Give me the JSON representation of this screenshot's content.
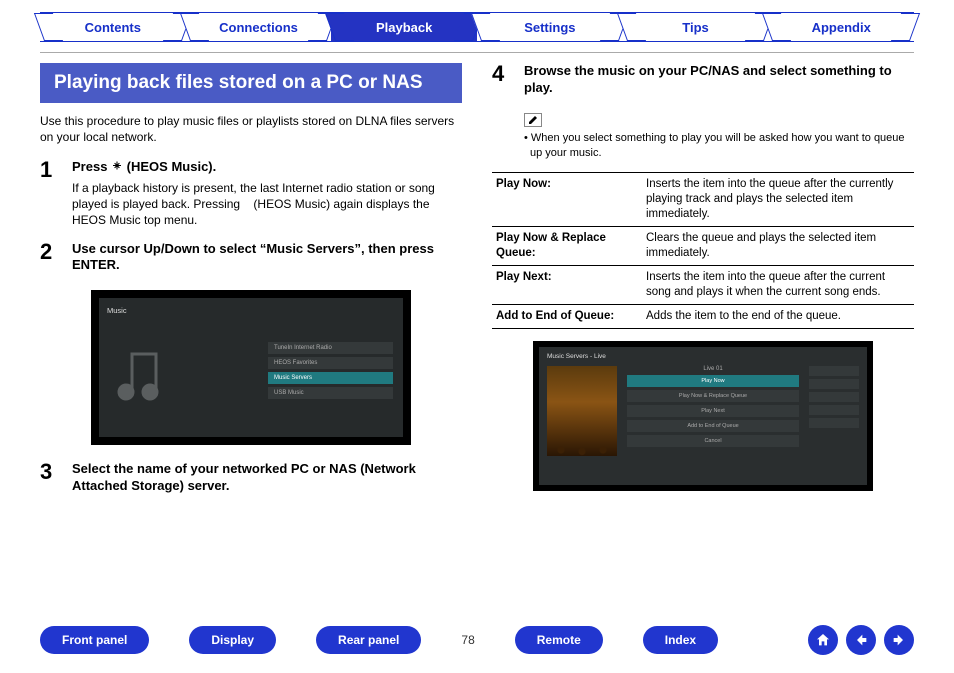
{
  "tabs": {
    "contents": "Contents",
    "connections": "Connections",
    "playback": "Playback",
    "settings": "Settings",
    "tips": "Tips",
    "appendix": "Appendix"
  },
  "section_title": "Playing back files stored on a PC or NAS",
  "intro": "Use this procedure to play music files or playlists stored on DLNA files servers on your local network.",
  "steps": {
    "s1": {
      "num": "1",
      "title_a": "Press ",
      "title_b": " (HEOS Music).",
      "text": "If a playback history is present, the last Internet radio station or song played is played back. Pressing    (HEOS Music) again displays the HEOS Music top menu."
    },
    "s2": {
      "num": "2",
      "title": "Use cursor Up/Down to select “Music Servers”, then press ENTER."
    },
    "s3": {
      "num": "3",
      "title": "Select the name of your networked PC or NAS (Network Attached Storage) server."
    },
    "s4": {
      "num": "4",
      "title": "Browse the music on your PC/NAS and select something to play."
    }
  },
  "note": "When you select something to play you will be asked how you want to queue up your music.",
  "queue": {
    "r1": {
      "k": "Play Now:",
      "v": "Inserts the item into the queue after the currently playing track and plays the selected item immediately."
    },
    "r2": {
      "k": "Play Now & Replace Queue:",
      "v": "Clears the queue and plays the selected item immediately."
    },
    "r3": {
      "k": "Play Next:",
      "v": "Inserts the item into the queue after the current song and plays it when the current song ends."
    },
    "r4": {
      "k": "Add to End of Queue:",
      "v": "Adds the item to the end of the queue."
    }
  },
  "shot1": {
    "title": "Music",
    "items": {
      "a": "TuneIn Internet Radio",
      "b": "HEOS Favorites",
      "c": "Music Servers",
      "d": "USB Music"
    }
  },
  "shot2": {
    "header": "Music Servers - Live",
    "live": "Live 01",
    "items": {
      "a": "Play Now",
      "b": "Play Now & Replace Queue",
      "c": "Play Next",
      "d": "Add to End of Queue",
      "e": "Cancel"
    }
  },
  "bottom": {
    "front": "Front panel",
    "display": "Display",
    "rear": "Rear panel",
    "page": "78",
    "remote": "Remote",
    "index": "Index"
  }
}
